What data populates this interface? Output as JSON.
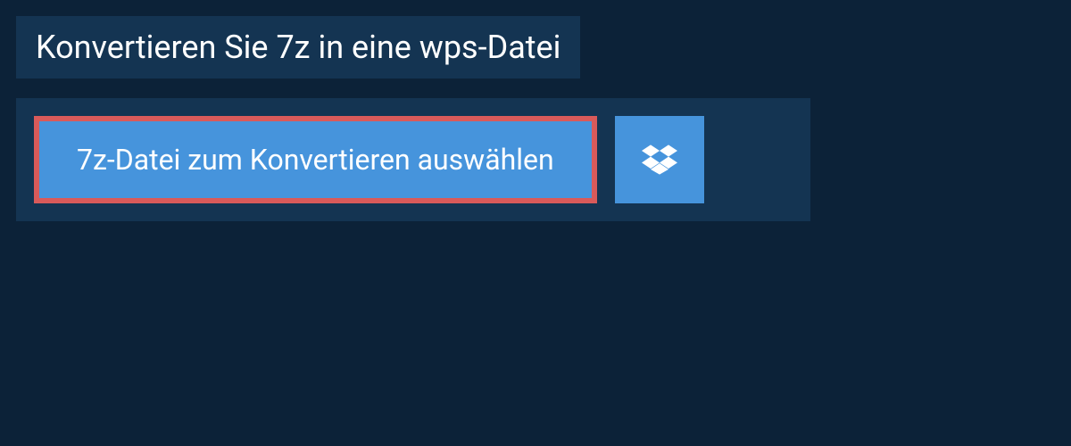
{
  "header": {
    "title": "Konvertieren Sie 7z in eine wps-Datei"
  },
  "upload": {
    "select_label": "7z-Datei zum Konvertieren auswählen"
  }
}
